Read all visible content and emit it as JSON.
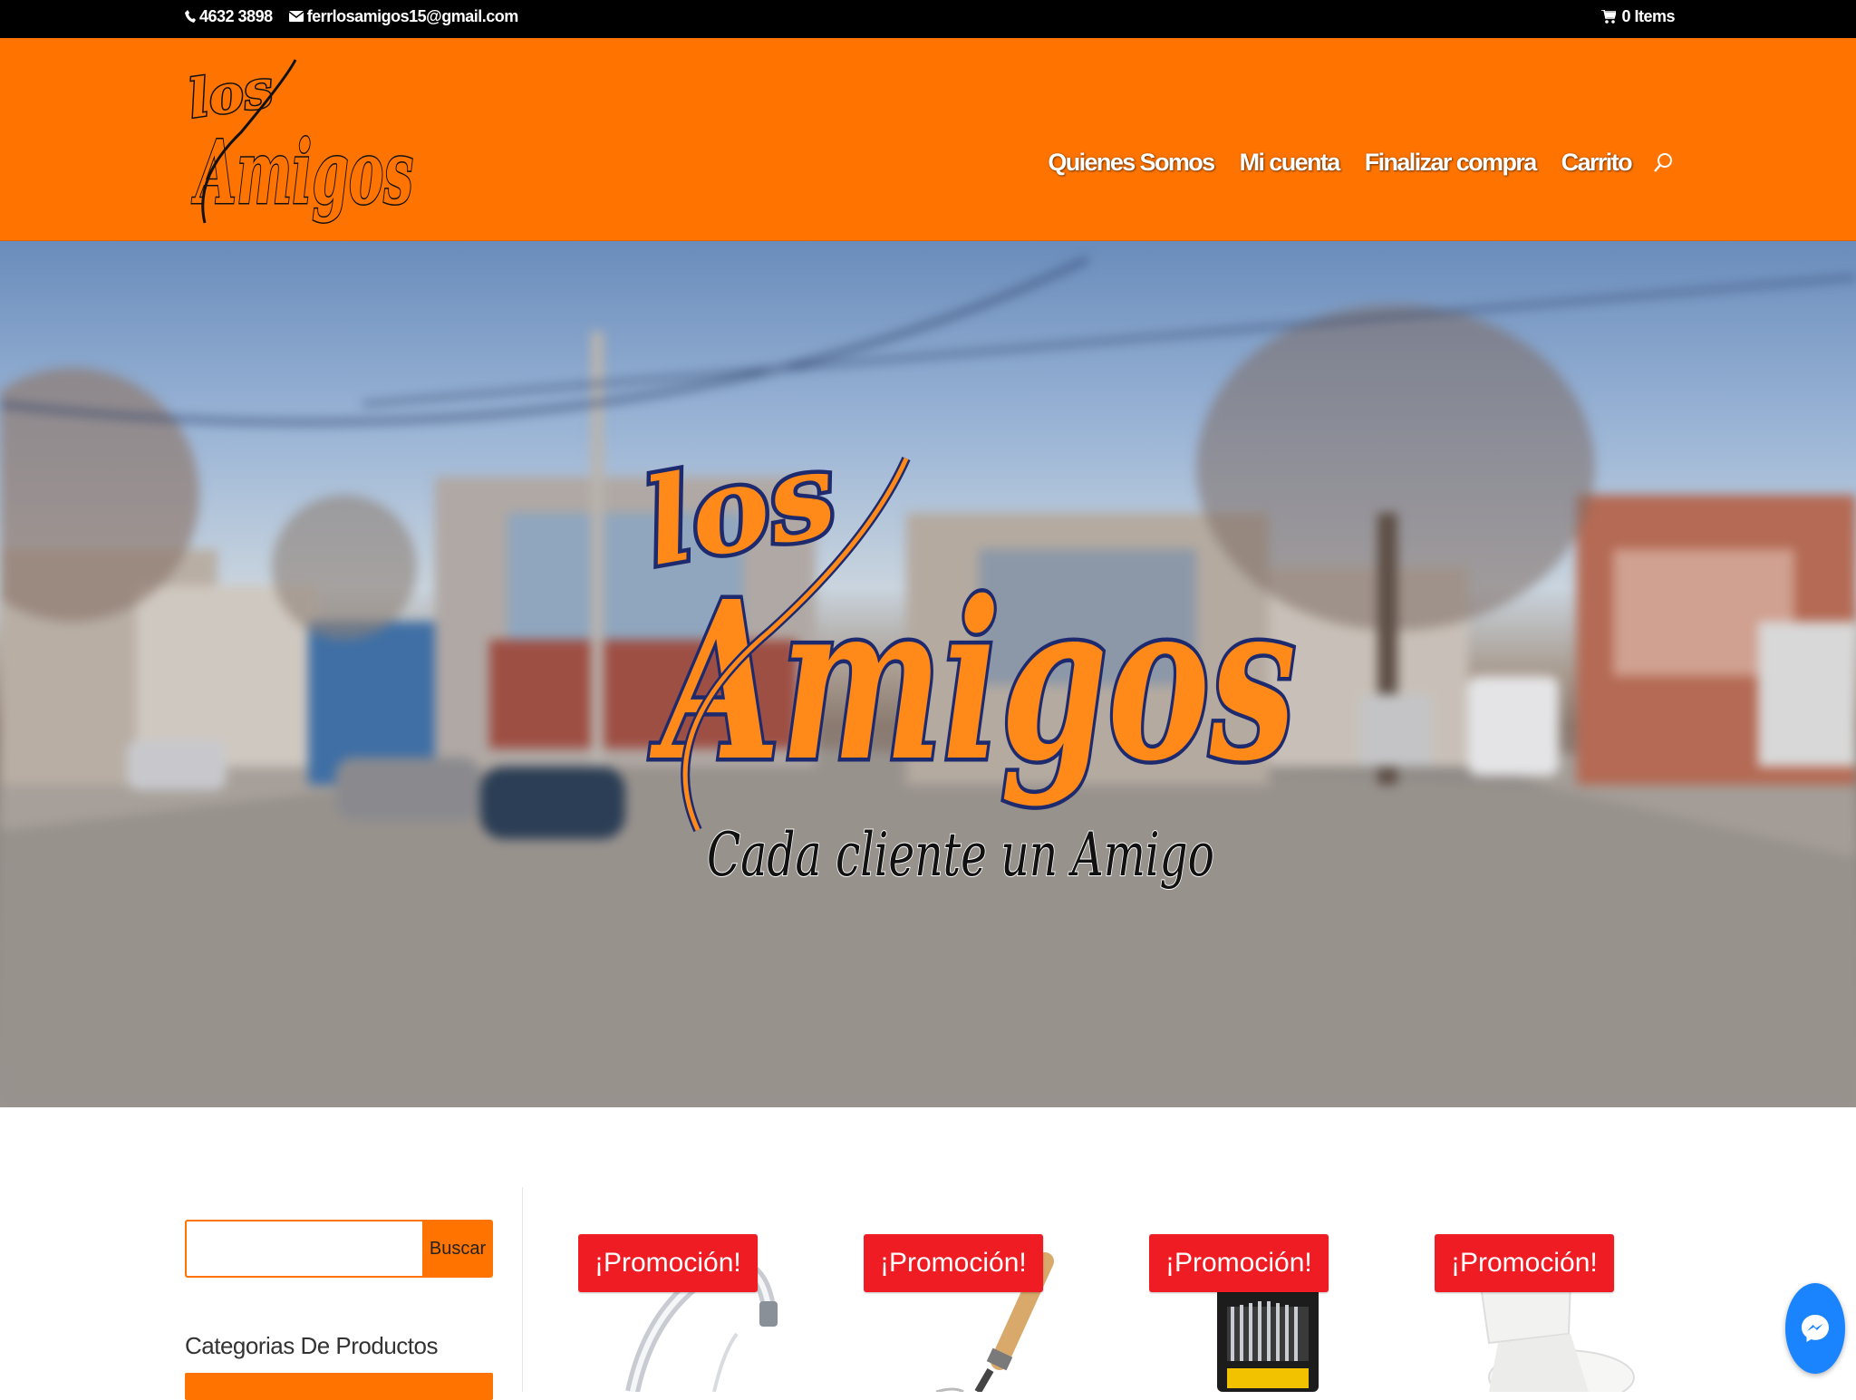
{
  "topbar": {
    "phone": "4632 3898",
    "email": "ferrlosamigos15@gmail.com",
    "cart": "0 Items"
  },
  "header": {
    "logo_text": [
      "los",
      "Amigos"
    ],
    "nav": [
      "Quienes Somos",
      "Mi cuenta",
      "Finalizar compra",
      "Carrito"
    ]
  },
  "hero": {
    "logo_text": [
      "los",
      "Amigos"
    ],
    "tagline": "Cada cliente un Amigo"
  },
  "sidebar": {
    "search_placeholder": "",
    "search_button": "Buscar",
    "categories_title": "Categorias De Productos"
  },
  "products": [
    {
      "badge": "¡Promoción!"
    },
    {
      "badge": "¡Promoción!"
    },
    {
      "badge": "¡Promoción!"
    },
    {
      "badge": "¡Promoción!"
    }
  ],
  "colors": {
    "brand_orange": "#ff7400",
    "promo_red": "#ef1c24",
    "topbar": "#000000",
    "messenger": "#1a84ff"
  }
}
